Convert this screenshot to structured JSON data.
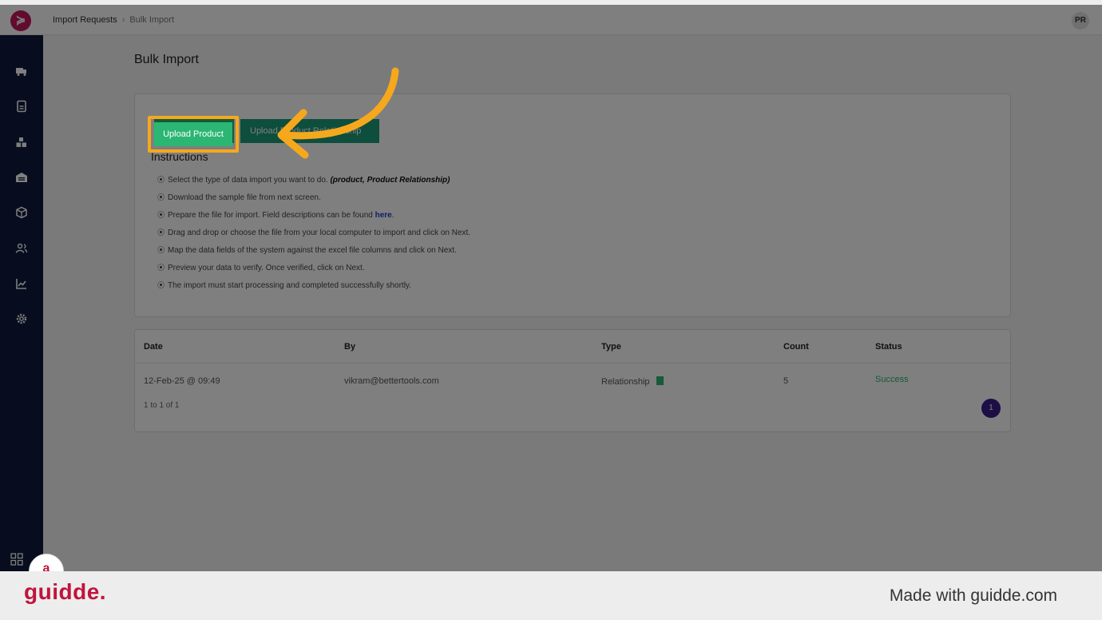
{
  "topbar": {
    "logo_glyph": "≽",
    "breadcrumb": [
      "Import Requests",
      "Bulk Import"
    ],
    "avatar_initials": "PR"
  },
  "sidebar": {
    "items": [
      {
        "name": "truck-icon"
      },
      {
        "name": "document-icon"
      },
      {
        "name": "boxes-icon"
      },
      {
        "name": "warehouse-icon"
      },
      {
        "name": "package-icon"
      },
      {
        "name": "users-icon"
      },
      {
        "name": "chart-icon"
      },
      {
        "name": "settings-icon"
      }
    ],
    "apps_icon": "grid-icon"
  },
  "page": {
    "title": "Bulk Import"
  },
  "buttons": {
    "upload_product": "Upload Product",
    "upload_relationship": "Upload Product Relationship"
  },
  "instructions": {
    "title": "Instructions",
    "items": {
      "i1_text": "Select the type of data import you want to do. ",
      "i1_bold": "(product, Product Relationship)",
      "i2": "Download the sample file from next screen.",
      "i3_text": "Prepare the file for import. Field descriptions can be found ",
      "i3_link": "here",
      "i3_end": ".",
      "i4": "Drag and drop or choose the file from your local computer to import and click on Next.",
      "i5": "Map the data fields of the system against the excel file columns and click on Next.",
      "i6": "Preview your data to verify. Once verified, click on Next.",
      "i7": "The import must start processing and completed successfully shortly."
    }
  },
  "table": {
    "headers": {
      "date": "Date",
      "by": "By",
      "type": "Type",
      "count": "Count",
      "status": "Status"
    },
    "rows": [
      {
        "date": "12-Feb-25 @ 09:49",
        "by": "vikram@bettertools.com",
        "type": "Relationship",
        "count": "5",
        "status": "Success"
      }
    ],
    "paging": "1 to 1 of 1",
    "page_number": "1"
  },
  "colors": {
    "accent_green": "#2bb673",
    "highlight": "#f6a81c",
    "sidebar": "#0f1a3d",
    "brand": "#c0143c"
  },
  "footer": {
    "brand": "guidde.",
    "made_with": "Made with guidde.com",
    "badge": "a"
  }
}
